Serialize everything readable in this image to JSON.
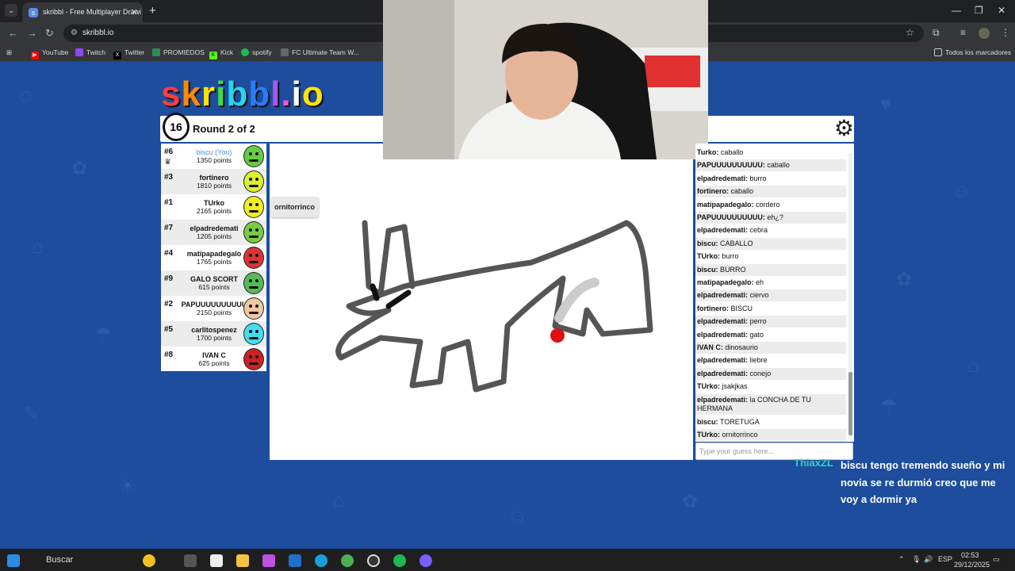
{
  "browser": {
    "tab_title": "skribbl - Free Multiplayer Drawi",
    "url": "skribbl.io",
    "bookmarks": [
      {
        "label": "YouTube",
        "color": "#ff0000"
      },
      {
        "label": "Twitch",
        "color": "#9146ff"
      },
      {
        "label": "Twitter",
        "color": "#000000"
      },
      {
        "label": "PROMIEDOS",
        "color": "#2e8b57"
      },
      {
        "label": "Kick",
        "color": "#53fc18"
      },
      {
        "label": "spotify",
        "color": "#1db954"
      },
      {
        "label": "FC Ultimate Team W...",
        "color": "#666666"
      }
    ],
    "all_bookmarks": "Todos los marcadores"
  },
  "game": {
    "logo": "skribbl.io",
    "timer": "16",
    "round": "Round 2 of 2",
    "current_word_bubble": "ornitorrinco",
    "players": [
      {
        "rank": "#6",
        "name": "biscu (You)",
        "points": "1350 points",
        "you": true,
        "color": "#66cc44"
      },
      {
        "rank": "#3",
        "name": "fortinero",
        "points": "1810 points",
        "you": false,
        "color": "#ddee33"
      },
      {
        "rank": "#1",
        "name": "TUrko",
        "points": "2165 points",
        "you": false,
        "color": "#eeee22"
      },
      {
        "rank": "#7",
        "name": "elpadredemati",
        "points": "1205 points",
        "you": false,
        "color": "#77cc44"
      },
      {
        "rank": "#4",
        "name": "matipapadegalo",
        "points": "1765 points",
        "you": false,
        "color": "#dd3333"
      },
      {
        "rank": "#9",
        "name": "GALO SCORT",
        "points": "615 points",
        "you": false,
        "color": "#55bb55"
      },
      {
        "rank": "#2",
        "name": "PAPUUUUUUUUUU",
        "points": "2150 points",
        "you": false,
        "color": "#f0c8a0"
      },
      {
        "rank": "#5",
        "name": "carlitospenez",
        "points": "1700 points",
        "you": false,
        "color": "#44ddee"
      },
      {
        "rank": "#8",
        "name": "IVAN C",
        "points": "625 points",
        "you": false,
        "color": "#cc2222"
      }
    ],
    "chat": [
      {
        "user": "Turko:",
        "text": "caballo"
      },
      {
        "user": "PAPUUUUUUUUUU:",
        "text": "caballo"
      },
      {
        "user": "elpadredemati:",
        "text": "burro"
      },
      {
        "user": "fortinero:",
        "text": "caballo"
      },
      {
        "user": "matipapadegalo:",
        "text": "cordero"
      },
      {
        "user": "PAPUUUUUUUUUU:",
        "text": "eh¿?"
      },
      {
        "user": "elpadredemati:",
        "text": "cebra"
      },
      {
        "user": "biscu:",
        "text": "CABALLO"
      },
      {
        "user": "TUrko:",
        "text": "burro"
      },
      {
        "user": "biscu:",
        "text": "BURRO"
      },
      {
        "user": "matipapadegalo:",
        "text": "eh"
      },
      {
        "user": "elpadredemati:",
        "text": "ciervo"
      },
      {
        "user": "fortinero:",
        "text": "BISCU"
      },
      {
        "user": "elpadredemati:",
        "text": "perro"
      },
      {
        "user": "elpadredemati:",
        "text": "gato"
      },
      {
        "user": "IVAN C:",
        "text": "dinosaurio"
      },
      {
        "user": "elpadredemati:",
        "text": "liebre"
      },
      {
        "user": "elpadredemati:",
        "text": "conejo"
      },
      {
        "user": "TUrko:",
        "text": "jsakjkas"
      },
      {
        "user": "elpadredemati:",
        "text": "la CONCHA DE TU HERMANA"
      },
      {
        "user": "biscu:",
        "text": "TORETUGA"
      },
      {
        "user": "TUrko:",
        "text": "ornitorrinco"
      }
    ],
    "guess_placeholder": "Type your guess here..."
  },
  "stream_overlay": {
    "user": "ThiaxZL",
    "message": "biscu tengo tremendo sueño y mi novia se re durmió creo que me voy a dormir ya"
  },
  "taskbar": {
    "search": "Buscar",
    "lang": "ESP",
    "time": "02:53",
    "date": "29/12/2025"
  }
}
